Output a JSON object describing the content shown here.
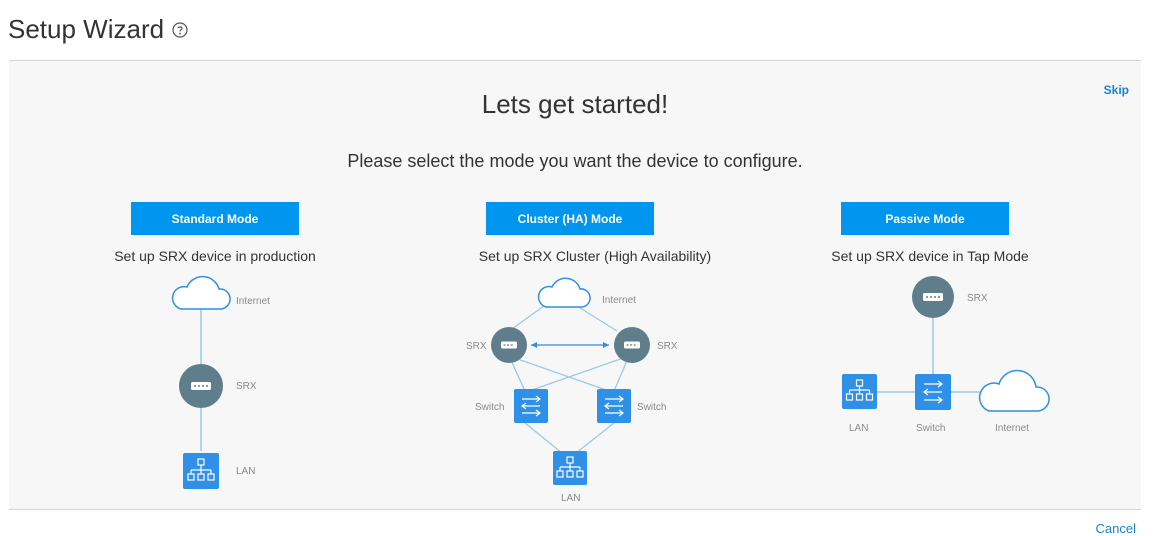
{
  "page": {
    "title": "Setup Wizard"
  },
  "wizard": {
    "skip_label": "Skip",
    "heading": "Lets get started!",
    "subheading": "Please select the mode you want the device to configure.",
    "cancel_label": "Cancel",
    "accent_color": "#0096f0",
    "link_color": "#1a82d3",
    "modes": [
      {
        "label": "Standard Mode",
        "description": "Set up SRX device in production",
        "diagram_labels": {
          "internet": "Internet",
          "srx": "SRX",
          "lan": "LAN"
        }
      },
      {
        "label": "Cluster (HA) Mode",
        "description": "Set up SRX Cluster (High Availability)",
        "diagram_labels": {
          "internet": "Internet",
          "srx_left": "SRX",
          "srx_right": "SRX",
          "switch_left": "Switch",
          "switch_right": "Switch",
          "lan": "LAN"
        }
      },
      {
        "label": "Passive Mode",
        "description": "Set up SRX device in Tap Mode",
        "diagram_labels": {
          "srx": "SRX",
          "lan": "LAN",
          "switch": "Switch",
          "internet": "Internet"
        }
      }
    ]
  },
  "icons": [
    "help-icon",
    "cloud-icon",
    "firewall-icon",
    "switch-icon",
    "network-icon"
  ]
}
